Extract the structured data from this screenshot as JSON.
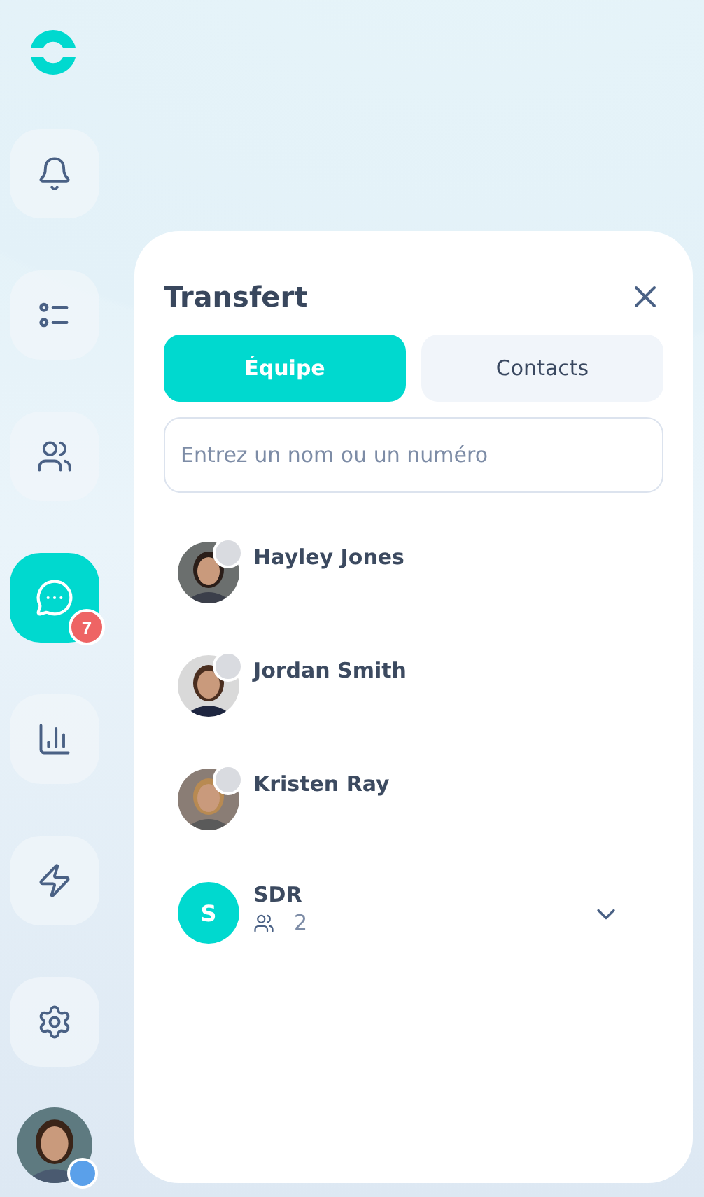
{
  "sidebar": {
    "items": [
      {
        "kind": "bell",
        "selected": false
      },
      {
        "kind": "list",
        "selected": false
      },
      {
        "kind": "people",
        "selected": false
      },
      {
        "kind": "chat",
        "selected": true,
        "badge": "7"
      },
      {
        "kind": "chart",
        "selected": false
      },
      {
        "kind": "bolt",
        "selected": false
      },
      {
        "kind": "gear",
        "selected": false
      }
    ],
    "user": {
      "color": "#5aa0ea"
    }
  },
  "panel": {
    "title": "Transfert",
    "tabs": [
      {
        "label": "Équipe",
        "selected": true
      },
      {
        "label": "Contacts",
        "selected": false
      }
    ],
    "search": {
      "placeholder": "Entrez un nom ou un numéro"
    },
    "contacts": [
      {
        "kind": "person",
        "name": "Hayley Jones",
        "color": "#d9dbe0"
      },
      {
        "kind": "person",
        "name": "Jordan Smith",
        "color": "#d9dbe0"
      },
      {
        "kind": "person",
        "name": "Kristen Ray",
        "color": "#d9dbe0"
      },
      {
        "kind": "group",
        "name": "SDR",
        "initial": "S",
        "members": "2",
        "expanded": false
      }
    ]
  }
}
